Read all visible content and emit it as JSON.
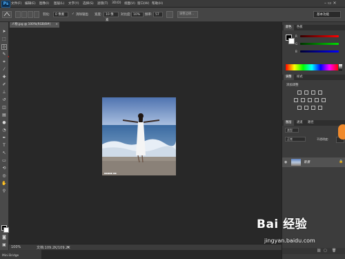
{
  "menubar": {
    "logo": "Ps",
    "items": [
      "文件(F)",
      "编辑(E)",
      "图像(I)",
      "图层(L)",
      "文字(Y)",
      "选择(S)",
      "滤镜(T)",
      "3D(D)",
      "视图(V)",
      "窗口(W)",
      "帮助(H)"
    ]
  },
  "options": {
    "feather_label": "羽化:",
    "feather_value": "0 像素",
    "antialias_label": "消除锯齿",
    "width_label": "宽度:",
    "width_value": "10 像素",
    "contrast_label": "对比度:",
    "contrast_value": "10%",
    "frequency_label": "频率:",
    "frequency_value": "57",
    "refine_edge": "调整边缘...",
    "workspace": "基本功能"
  },
  "document": {
    "tab_title": "人物.jpg @ 100%(RGB/8#)",
    "tab_close": "×"
  },
  "status": {
    "zoom": "100%",
    "doc_info": "文档:109.2K/109.2K",
    "bottom_tab": "Mini Bridge"
  },
  "panels": {
    "color_tabs": [
      "颜色",
      "色板"
    ],
    "adjust_tabs": [
      "调整",
      "样式"
    ],
    "adjust_title": "添加调整",
    "layer_tabs": [
      "图层",
      "通道",
      "路径"
    ],
    "layer_kind": "类型",
    "layer_mode": "正常",
    "layer_opacity": "不透明度:",
    "layer_name": "背景"
  },
  "watermark": {
    "brand": "Bai 经验",
    "url": "jingyan.baidu.com"
  },
  "colors": {
    "annotation_arrow": "#c0201c",
    "ps_blue": "#4fb2ff"
  }
}
